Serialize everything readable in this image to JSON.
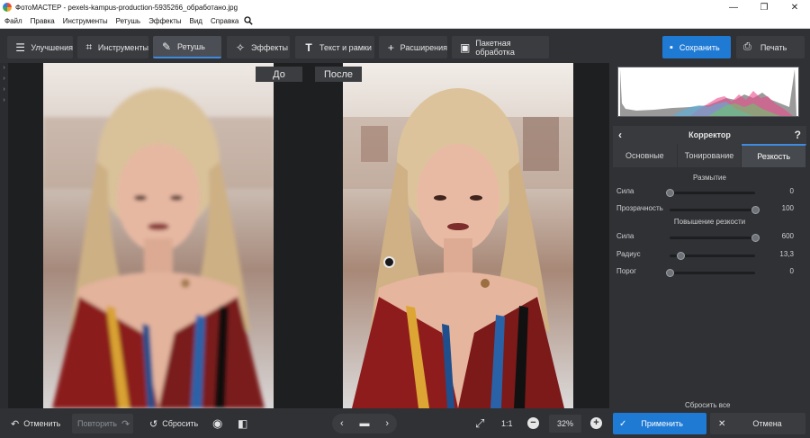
{
  "window": {
    "title": "ФотоМАСТЕР - pexels-kampus-production-5935266_обработано.jpg",
    "controls": [
      "—",
      "❐",
      "✕"
    ]
  },
  "menu": [
    "Файл",
    "Правка",
    "Инструменты",
    "Ретушь",
    "Эффекты",
    "Вид",
    "Справка"
  ],
  "toolbar": {
    "tabs": [
      {
        "label": "Улучшения",
        "icon": "sliders-icon",
        "active": false
      },
      {
        "label": "Инструменты",
        "icon": "crop-icon",
        "active": false
      },
      {
        "label": "Ретушь",
        "icon": "brush-icon",
        "active": true
      },
      {
        "label": "Эффекты",
        "icon": "sparkle-icon",
        "active": false
      },
      {
        "label": "Текст и рамки",
        "icon": "text-icon",
        "active": false
      },
      {
        "label": "Расширения",
        "icon": "plus-icon",
        "active": false
      },
      {
        "label": "Пакетная обработка",
        "icon": "batch-icon",
        "active": false
      }
    ],
    "save_label": "Сохранить",
    "print_label": "Печать"
  },
  "canvas": {
    "before_label": "До",
    "after_label": "После"
  },
  "panel": {
    "title": "Корректор",
    "help": "?",
    "tabs": [
      {
        "label": "Основные",
        "active": false
      },
      {
        "label": "Тонирование",
        "active": false
      },
      {
        "label": "Резкость",
        "active": true
      }
    ],
    "blur_section": "Размытие",
    "sharpen_section": "Повышение резкости",
    "sliders": [
      {
        "label": "Сила",
        "value": "0",
        "pos": 0.0
      },
      {
        "label": "Прозрачность",
        "value": "100",
        "pos": 1.0
      },
      {
        "label": "Сила",
        "value": "600",
        "pos": 1.0
      },
      {
        "label": "Радиус",
        "value": "13,3",
        "pos": 0.13
      },
      {
        "label": "Порог",
        "value": "0",
        "pos": 0.0
      }
    ],
    "reset_all": "Сбросить все"
  },
  "bottom": {
    "undo": "Отменить",
    "redo": "Повторить",
    "reset": "Сбросить",
    "zoom_ratio": "1:1",
    "zoom_value": "32%",
    "apply": "Применить",
    "cancel": "Отмена"
  },
  "colors": {
    "accent": "#1f7ad4",
    "panel_bg": "#2f3135",
    "canvas_bg": "#1e1f21"
  }
}
